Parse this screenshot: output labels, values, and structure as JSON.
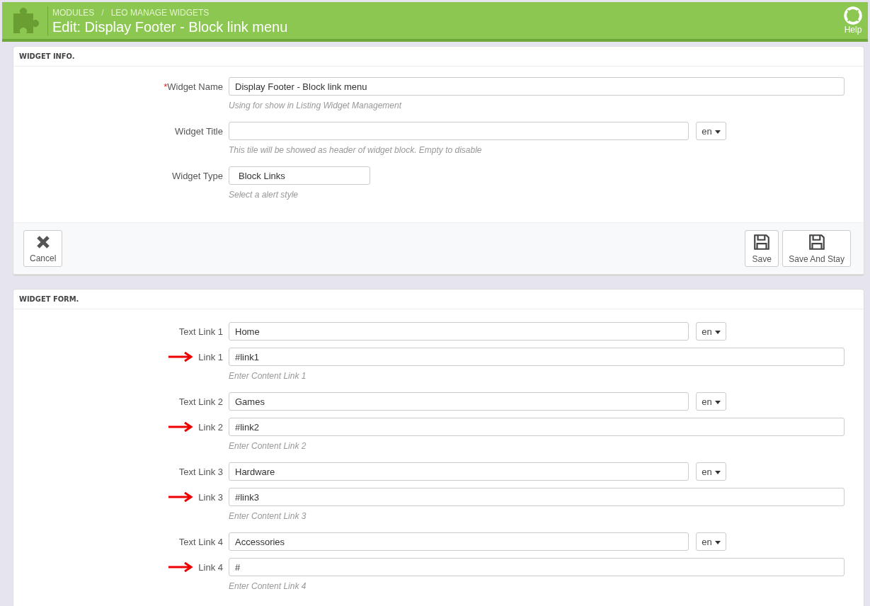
{
  "header": {
    "breadcrumb": [
      "MODULES",
      "LEO MANAGE WIDGETS"
    ],
    "breadcrumb_separator": "/",
    "title": "Edit: Display Footer - Block link menu",
    "help": "Help"
  },
  "widget_info": {
    "heading": "WIDGET INFO.",
    "fields": [
      {
        "kind": "text",
        "label": "Widget Name",
        "required": true,
        "value": "Display Footer - Block link menu",
        "help": "Using for show in Listing Widget Management"
      },
      {
        "kind": "lang",
        "label": "Widget Title",
        "required": false,
        "lang": "en",
        "help": "This tile will be showed as header of widget block. Empty to disable"
      },
      {
        "kind": "select",
        "label": "Widget Type",
        "required": false,
        "value": "Block Links",
        "help": "Select a alert style"
      }
    ],
    "required_mark": "*",
    "buttons": [
      {
        "kind": "cancel",
        "label": "Cancel"
      },
      {
        "kind": "save",
        "label": "Save"
      },
      {
        "kind": "save",
        "label": "Save And Stay"
      }
    ]
  },
  "widget_form": {
    "heading": "WIDGET FORM.",
    "links": [
      {
        "text_label": "Text Link 1",
        "text_value": "Home",
        "lang": "en",
        "link_label": "Link 1",
        "link_value": "#link1",
        "help": "Enter Content Link 1",
        "arrow": true
      },
      {
        "text_label": "Text Link 2",
        "text_value": "Games",
        "lang": "en",
        "link_label": "Link 2",
        "link_value": "#link2",
        "help": "Enter Content Link 2",
        "arrow": true
      },
      {
        "text_label": "Text Link 3",
        "text_value": "Hardware",
        "lang": "en",
        "link_label": "Link 3",
        "link_value": "#link3",
        "help": "Enter Content Link 3",
        "arrow": true
      },
      {
        "text_label": "Text Link 4",
        "text_value": "Accessories",
        "lang": "en",
        "link_label": "Link 4",
        "link_value": "#",
        "help": "Enter Content Link 4",
        "arrow": true
      }
    ]
  }
}
